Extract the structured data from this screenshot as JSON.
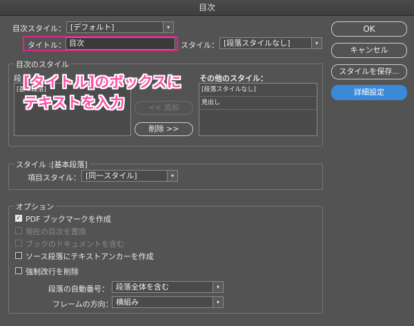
{
  "window": {
    "title": "目次"
  },
  "toc_style": {
    "label": "目次スタイル：",
    "value": "[デフォルト]"
  },
  "title_row": {
    "label": "タイトル：",
    "value": "目次",
    "style_label": "スタイル：",
    "style_value": "[段落スタイルなし]"
  },
  "toc_styles_group": {
    "legend": "目次のスタイル",
    "included_label": "段",
    "included_items": [
      "[基本段落]"
    ],
    "add_button": "<< 追加",
    "remove_button": "削除 >>",
    "other_label": "その他のスタイル：",
    "other_items": [
      "[段落スタイルなし]",
      "見出し"
    ]
  },
  "callout": {
    "line1": "[タイトル]のボックスに",
    "line2": "テキストを入力"
  },
  "style_group": {
    "legend": "スタイル :[基本段落]",
    "entry_label": "項目スタイル：",
    "entry_value": "[同一スタイル]"
  },
  "options_group": {
    "legend": "オプション",
    "checkboxes": [
      {
        "label": "PDF ブックマークを作成",
        "checked": true,
        "enabled": true
      },
      {
        "label": "現在の目次を置換",
        "checked": false,
        "enabled": false
      },
      {
        "label": "ブックのドキュメントを含む",
        "checked": false,
        "enabled": false
      },
      {
        "label": "ソース段落にテキストアンカーを作成",
        "checked": false,
        "enabled": true
      },
      {
        "label": "強制改行を削除",
        "checked": false,
        "enabled": true
      }
    ],
    "numbering_label": "段落の自動番号：",
    "numbering_value": "段落全体を含む",
    "frame_dir_label": "フレームの方向：",
    "frame_dir_value": "横組み"
  },
  "buttons": {
    "ok": "OK",
    "cancel": "キャンセル",
    "save_style": "スタイルを保存...",
    "details": "詳細設定"
  },
  "colors": {
    "accent": "#3b8ad9",
    "highlight": "#e0258c",
    "callout": "#ff4fa8"
  }
}
